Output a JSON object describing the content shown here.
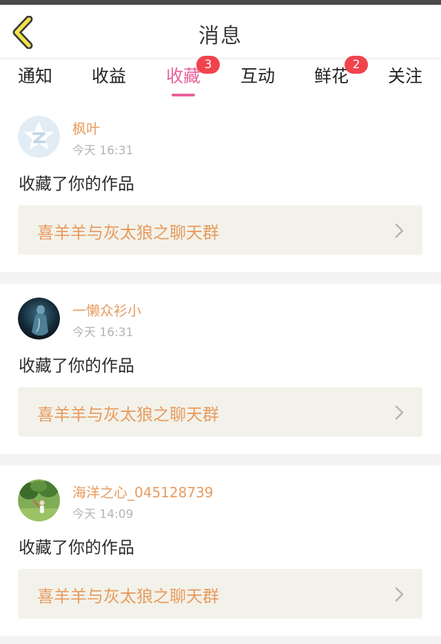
{
  "header": {
    "title": "消息",
    "back_icon": "chevron-left-icon"
  },
  "tabs": [
    {
      "label": "通知",
      "active": false
    },
    {
      "label": "收益",
      "active": false
    },
    {
      "label": "收藏",
      "active": true,
      "badge": "3"
    },
    {
      "label": "互动",
      "active": false
    },
    {
      "label": "鲜花",
      "active": false,
      "badge": "2"
    },
    {
      "label": "关注",
      "active": false
    }
  ],
  "colors": {
    "accent_pink": "#e8609a",
    "username_orange": "#e79b5f",
    "badge_red": "#f0444d",
    "back_arrow_yellow": "#f2e24b"
  },
  "notifications": [
    {
      "user": "枫叶",
      "time": "今天 16:31",
      "action": "收藏了你的作品",
      "work": "喜羊羊与灰太狼之聊天群",
      "avatar_icon": "qq-star-avatar-icon"
    },
    {
      "user": "一懒众衫小",
      "time": "今天 16:31",
      "action": "收藏了你的作品",
      "work": "喜羊羊与灰太狼之聊天群",
      "avatar_icon": "dark-figure-avatar-icon"
    },
    {
      "user": "海洋之心_045128739",
      "time": "今天 14:09",
      "action": "收藏了你的作品",
      "work": "喜羊羊与灰太狼之聊天群",
      "avatar_icon": "outdoor-photo-avatar-icon"
    }
  ]
}
